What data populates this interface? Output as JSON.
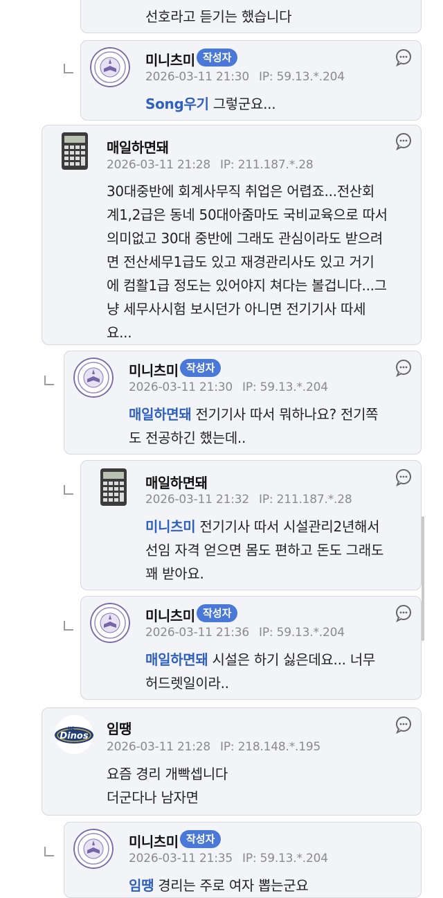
{
  "comments": [
    {
      "id": "c0",
      "nickname": "",
      "badge": "",
      "date": "",
      "ip_label": "",
      "ip": "",
      "mention": "",
      "text": [
        "선호라고 듣기는 했습니다"
      ],
      "avatar": "none"
    },
    {
      "id": "c1",
      "nickname": "미니츠미",
      "badge": "작성자",
      "date": "2026-03-11 21:30",
      "ip_label": "IP:",
      "ip": "59.13.*.204",
      "mention": "Song우기",
      "text": [
        "그렇군요..."
      ],
      "avatar": "seal"
    },
    {
      "id": "c2",
      "nickname": "매일하면돼",
      "badge": "",
      "date": "2026-03-11 21:28",
      "ip_label": "IP:",
      "ip": "211.187.*.28",
      "mention": "",
      "text": [
        "30대중반에 회계사무직 취업은 어렵죠...전산회",
        "계1,2급은 동네 50대아줌마도 국비교육으로 따서",
        "의미없고 30대 중반에 그래도 관심이라도 받으려",
        "면 전산세무1급도 있고 재경관리사도 있고 거기",
        "에 컴활1급 정도는 있어야지 쳐다는 볼겁니다...그",
        "냥 세무사시험 보시던가 아니면 전기기사 따세",
        "요..."
      ],
      "avatar": "calculator"
    },
    {
      "id": "c3",
      "nickname": "미니츠미",
      "badge": "작성자",
      "date": "2026-03-11 21:30",
      "ip_label": "IP:",
      "ip": "59.13.*.204",
      "mention": "매일하면돼",
      "text": [
        "전기기사 따서 뭐하나요? 전기쪽",
        "도 전공하긴 했는데.."
      ],
      "avatar": "seal"
    },
    {
      "id": "c4",
      "nickname": "매일하면돼",
      "badge": "",
      "date": "2026-03-11 21:32",
      "ip_label": "IP:",
      "ip": "211.187.*.28",
      "mention": "미니츠미",
      "text": [
        "전기기사 따서 시설관리2년해서",
        "선임 자격 얻으면 몸도 편하고 돈도 그래도",
        "꽤 받아요."
      ],
      "avatar": "calculator"
    },
    {
      "id": "c5",
      "nickname": "미니츠미",
      "badge": "작성자",
      "date": "2026-03-11 21:36",
      "ip_label": "IP:",
      "ip": "59.13.*.204",
      "mention": "매일하면돼",
      "text": [
        "시설은 하기 싫은데요... 너무",
        "허드렛일이라.."
      ],
      "avatar": "seal"
    },
    {
      "id": "c6",
      "nickname": "임땡",
      "badge": "",
      "date": "2026-03-11 21:28",
      "ip_label": "IP:",
      "ip": "218.148.*.195",
      "mention": "",
      "text": [
        "요즘 경리 개빡셉니다",
        "더군다나 남자면"
      ],
      "avatar": "dinos"
    },
    {
      "id": "c7",
      "nickname": "미니츠미",
      "badge": "작성자",
      "date": "2026-03-11 21:35",
      "ip_label": "IP:",
      "ip": "59.13.*.204",
      "mention": "임땡",
      "text": [
        "경리는 주로 여자 뽑는군요"
      ],
      "avatar": "seal"
    }
  ],
  "icons": {
    "reply": "reply-bubble-icon",
    "thread": "reply-thread-icon",
    "seal": "university-seal-icon",
    "calculator": "calculator-icon",
    "dinos": "dinos-logo-icon"
  },
  "colors": {
    "card_bg": "#f3f4f8",
    "card_border": "#d6d8de",
    "badge_bg": "#4a78d6",
    "mention": "#2f5fbf",
    "meta": "#8a8a8a"
  }
}
